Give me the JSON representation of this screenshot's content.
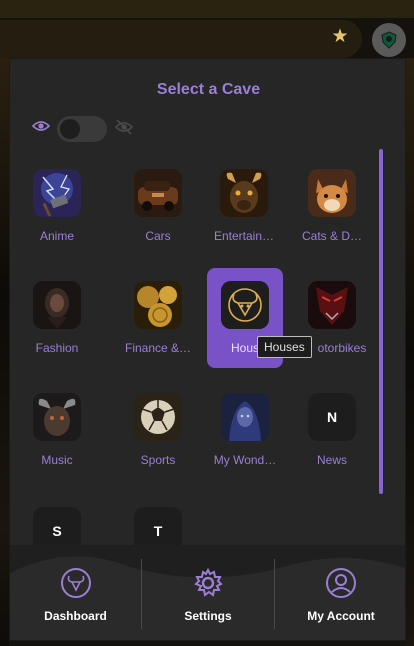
{
  "browser": {
    "bookmark_icon": "star-icon",
    "extension_icon": "shield-logo-icon"
  },
  "popup": {
    "title": "Select a Cave",
    "visibility_toggle": {
      "on_icon": "eye-icon",
      "off_icon": "eye-off-icon",
      "state": "off"
    },
    "caves": [
      {
        "label": "Anime",
        "thumb": "anime"
      },
      {
        "label": "Cars",
        "thumb": "cars"
      },
      {
        "label": "Entertain…",
        "thumb": "entertainment"
      },
      {
        "label": "Cats & D…",
        "thumb": "cats"
      },
      {
        "label": "Fashion",
        "thumb": "fashion"
      },
      {
        "label": "Finance &…",
        "thumb": "finance"
      },
      {
        "label": "Hous",
        "thumb": "houses",
        "selected": true
      },
      {
        "label": "otorbikes",
        "thumb": "motorbikes"
      },
      {
        "label": "Music",
        "thumb": "music"
      },
      {
        "label": "Sports",
        "thumb": "sports"
      },
      {
        "label": "My Wond…",
        "thumb": "wonder"
      },
      {
        "label": "News",
        "letter": "N"
      },
      {
        "label": "",
        "letter": "S"
      },
      {
        "label": "",
        "letter": "T"
      }
    ],
    "tooltip": "Houses"
  },
  "footer": {
    "dashboard": "Dashboard",
    "settings": "Settings",
    "account": "My Account"
  },
  "colors": {
    "accent": "#9b7fd6",
    "selected": "#7a52c7",
    "panel": "#262626"
  }
}
